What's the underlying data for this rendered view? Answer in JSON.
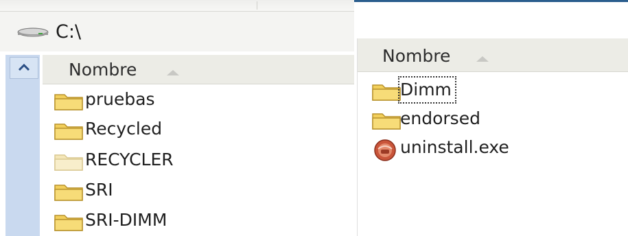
{
  "left_window": {
    "address": "C:\\",
    "column_header": "Nombre",
    "files": [
      {
        "name": "pruebas",
        "icon": "folder-icon",
        "faded": false
      },
      {
        "name": "Recycled",
        "icon": "folder-icon",
        "faded": false
      },
      {
        "name": "RECYCLER",
        "icon": "folder-icon",
        "faded": true
      },
      {
        "name": "SRI",
        "icon": "folder-icon",
        "faded": false
      },
      {
        "name": "SRI-DIMM",
        "icon": "folder-icon",
        "faded": false
      }
    ]
  },
  "right_window": {
    "column_header": "Nombre",
    "files": [
      {
        "name": "Dimm",
        "icon": "folder-icon",
        "focused": true
      },
      {
        "name": "endorsed",
        "icon": "folder-icon",
        "focused": false
      },
      {
        "name": "uninstall.exe",
        "icon": "uninstall-exe-icon",
        "focused": false
      }
    ]
  },
  "colors": {
    "folder": "#f2cf5b",
    "folder_faded": "#f4e6b8",
    "header_bg": "#ecece6",
    "rail": "#c9d9ef",
    "accent_bar": "#2a5d8d"
  }
}
